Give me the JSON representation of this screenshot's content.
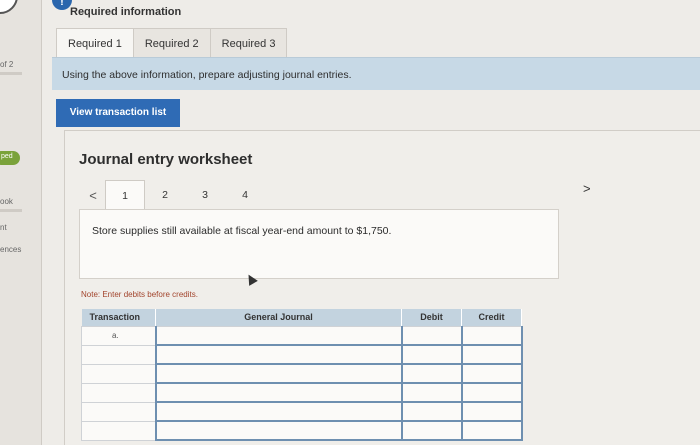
{
  "sidebar": {
    "page_fragment": "of 2",
    "badge": "ped",
    "label_ok": "ook",
    "label_nt": "nt",
    "label_ences": "ences"
  },
  "header": {
    "info_icon": "!",
    "required_info": "Required information"
  },
  "tabs": [
    {
      "label": "Required 1",
      "active": true
    },
    {
      "label": "Required 2",
      "active": false
    },
    {
      "label": "Required 3",
      "active": false
    }
  ],
  "instruction": "Using the above information, prepare adjusting journal entries.",
  "view_button": "View transaction list",
  "worksheet": {
    "title": "Journal entry worksheet",
    "prev_arrow": "<",
    "next_arrow": ">",
    "pages": [
      "1",
      "2",
      "3",
      "4"
    ],
    "active_page": "1",
    "description": "Store supplies still available at fiscal year-end amount to $1,750.",
    "note": "Note: Enter debits before credits."
  },
  "journal_table": {
    "headers": [
      "Transaction",
      "General Journal",
      "Debit",
      "Credit"
    ],
    "rows": [
      {
        "transaction": "a."
      },
      {
        "transaction": ""
      },
      {
        "transaction": ""
      },
      {
        "transaction": ""
      },
      {
        "transaction": ""
      },
      {
        "transaction": ""
      }
    ]
  },
  "colors": {
    "accent_blue": "#2f6bb5",
    "instruction_bar": "#c7d9e6",
    "table_header": "#c3d3df",
    "note_red": "#a2442c"
  }
}
